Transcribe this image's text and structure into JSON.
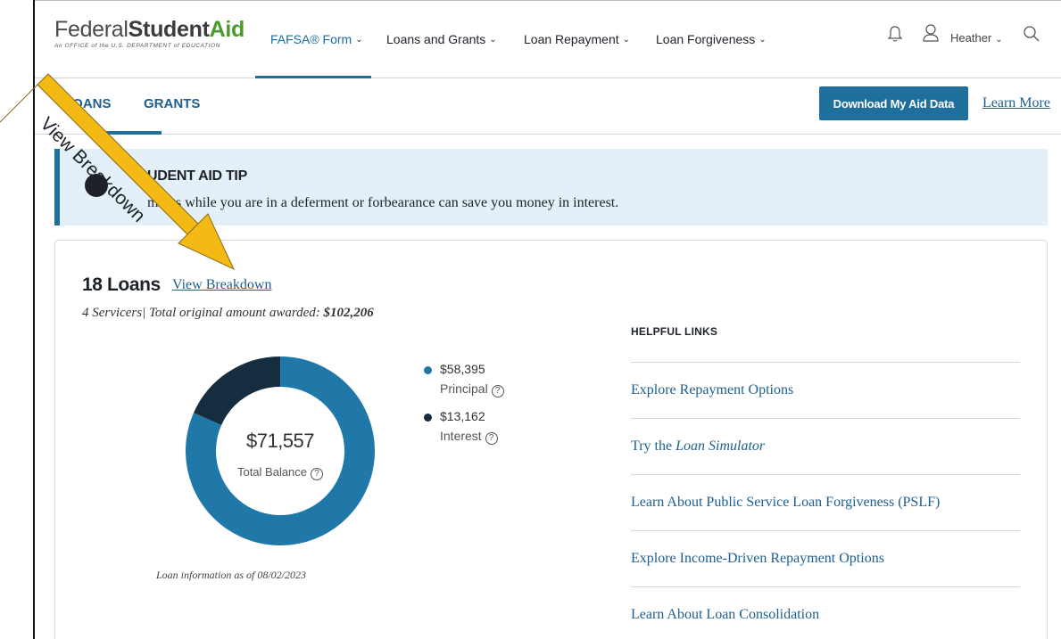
{
  "header": {
    "logo": {
      "federal": "Federal",
      "student": "Student",
      "aid": "Aid",
      "subtitle": "An OFFICE of the U.S. DEPARTMENT of EDUCATION"
    },
    "nav": [
      {
        "label": "FAFSA® Form"
      },
      {
        "label": "Loans and Grants"
      },
      {
        "label": "Loan Repayment"
      },
      {
        "label": "Loan Forgiveness"
      }
    ],
    "user_name": "Heather",
    "icons": {
      "notifications": "bell-icon",
      "user": "user-icon",
      "search": "search-icon"
    }
  },
  "tabs": {
    "loans": "LOANS",
    "grants": "GRANTS",
    "download_label": "Download My Aid Data",
    "learn_more": "Learn More"
  },
  "tip": {
    "title": "STUDENT AID TIP",
    "title_visible": "UDENT AID TIP",
    "body": "ments while you are in a deferment or forbearance can save you money in interest."
  },
  "loans": {
    "title": "18 Loans",
    "view_breakdown": "View Breakdown",
    "servicers": "4 Servicers",
    "awarded_label": "Total original amount awarded:",
    "awarded_value": "$102,206",
    "total_value": "$71,557",
    "total_label": "Total Balance",
    "principal_value": "$58,395",
    "principal_label": "Principal",
    "interest_value": "$13,162",
    "interest_label": "Interest",
    "as_of": "Loan information as of 08/02/2023"
  },
  "chart_data": {
    "type": "pie",
    "categories": [
      "Principal",
      "Interest"
    ],
    "values": [
      58395,
      13162
    ],
    "colors": [
      "#1f78a8",
      "#152d3e"
    ]
  },
  "helpful": {
    "title": "HELPFUL LINKS",
    "links": [
      {
        "label": "Explore Repayment Options"
      },
      {
        "label": "Try the",
        "italic": "Loan Simulator"
      },
      {
        "label": "Learn About Public Service Loan Forgiveness (PSLF)"
      },
      {
        "label": "Explore Income-Driven Repayment Options"
      },
      {
        "label": "Learn About Loan Consolidation"
      }
    ]
  },
  "annotation": {
    "label": "View Breakdown",
    "color": "#f5b915"
  },
  "colors": {
    "brand_blue": "#1f6f9d",
    "link_blue": "#1d5f8e",
    "tip_bg": "#e3f0f7",
    "logo_green": "#4b9a2e"
  }
}
